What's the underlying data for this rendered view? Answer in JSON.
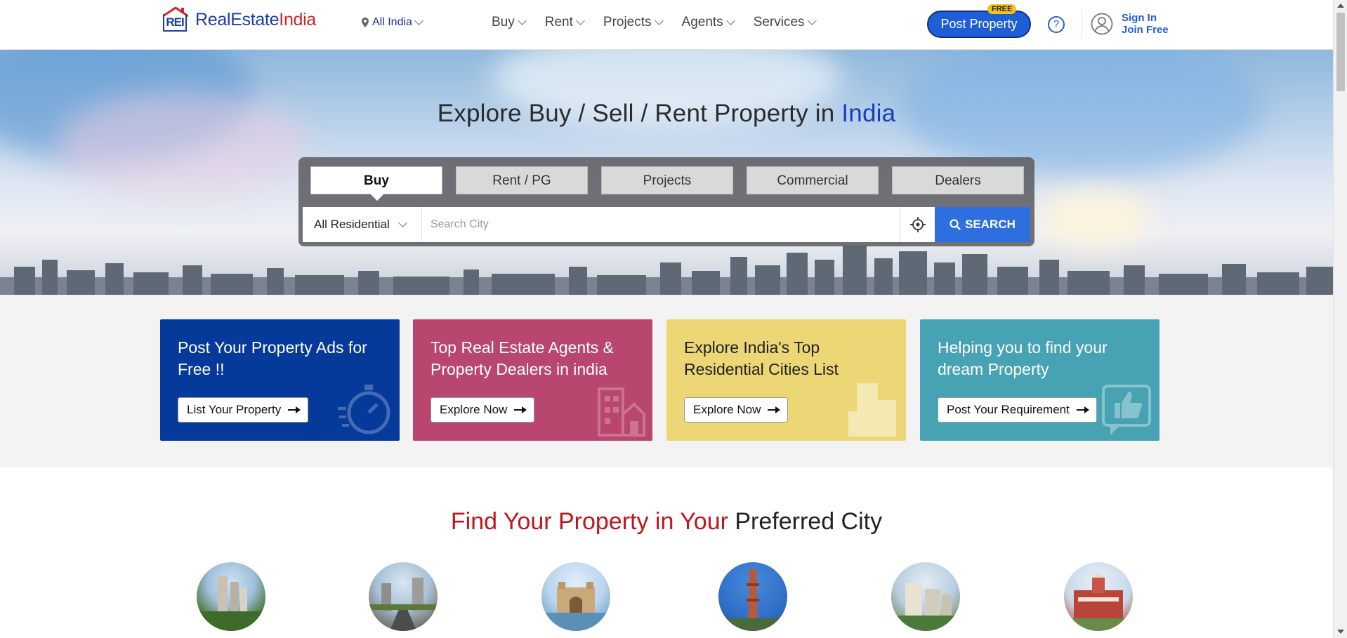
{
  "header": {
    "logo_mark": "REI",
    "logo_text_1": "RealEstate",
    "logo_text_2": "India",
    "location": "All India",
    "nav": [
      {
        "label": "Buy"
      },
      {
        "label": "Rent"
      },
      {
        "label": "Projects"
      },
      {
        "label": "Agents"
      },
      {
        "label": "Services"
      }
    ],
    "post_property": "Post Property",
    "free_badge": "FREE",
    "help_icon": "?",
    "sign_in": "Sign In",
    "join_free": "Join Free"
  },
  "hero": {
    "title_prefix": "Explore Buy / Sell / Rent Property in ",
    "title_highlight": "India",
    "tabs": [
      {
        "label": "Buy",
        "active": true
      },
      {
        "label": "Rent / PG",
        "active": false
      },
      {
        "label": "Projects",
        "active": false
      },
      {
        "label": "Commercial",
        "active": false
      },
      {
        "label": "Dealers",
        "active": false
      }
    ],
    "category_select": "All Residential",
    "search_placeholder": "Search City",
    "search_button": "SEARCH"
  },
  "promos": [
    {
      "title": "Post Your Property Ads for Free !!",
      "button": "List Your Property",
      "bg": "#05399a",
      "text_color": "#ffffff",
      "icon": "stopwatch-icon"
    },
    {
      "title": "Top Real Estate Agents & Property Dealers in india",
      "button": "Explore Now",
      "bg": "#b8466e",
      "text_color": "#ffffff",
      "icon": "building-icon"
    },
    {
      "title": "Explore India's Top Residential Cities List",
      "button": "Explore Now",
      "bg": "#ecd675",
      "text_color": "#222222",
      "icon": "tower-icon"
    },
    {
      "title": "Helping you to find your dream Property",
      "button": "Post Your Requirement",
      "bg": "#47a3b3",
      "text_color": "#ffffff",
      "icon": "thumbs-up-icon"
    }
  ],
  "cities_section": {
    "title_part1": "Find Your Property in Your ",
    "title_part2": "Preferred City"
  },
  "colors": {
    "brand_blue": "#1a3fa8",
    "brand_red": "#d2232a",
    "search_blue": "#2e6fe0"
  }
}
